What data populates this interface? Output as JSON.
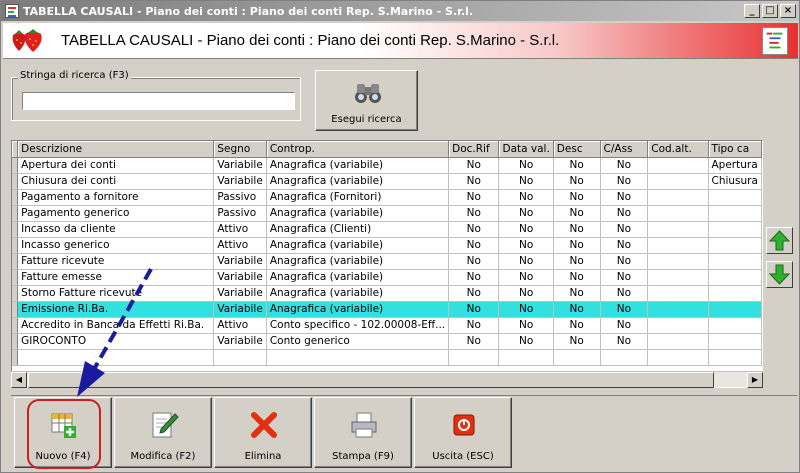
{
  "window": {
    "title": "TABELLA CAUSALI - Piano dei conti : Piano dei conti Rep. S.Marino - S.r.l.",
    "controls": [
      "_",
      "□",
      "×"
    ]
  },
  "banner": {
    "title": "TABELLA CAUSALI - Piano dei conti : Piano dei conti Rep. S.Marino - S.r.l."
  },
  "search": {
    "legend": "Stringa di ricerca (F3)",
    "value": "",
    "button_label": "Esegui ricerca",
    "button_icon": "binoculars-icon"
  },
  "grid": {
    "columns": [
      "Descrizione",
      "Segno",
      "Controp.",
      "Doc.Rif",
      "Data val.",
      "Desc",
      "C/Ass",
      "Cod.alt.",
      "Tipo ca"
    ],
    "rows": [
      [
        "Apertura dei conti",
        "Variabile",
        "Anagrafica (variabile)",
        "No",
        "No",
        "No",
        "No",
        "",
        "Apertura"
      ],
      [
        "Chiusura dei conti",
        "Variabile",
        "Anagrafica (variabile)",
        "No",
        "No",
        "No",
        "No",
        "",
        "Chiusura"
      ],
      [
        "Pagamento a fornitore",
        "Passivo",
        "Anagrafica (Fornitori)",
        "No",
        "No",
        "No",
        "No",
        "",
        ""
      ],
      [
        "Pagamento generico",
        "Passivo",
        "Anagrafica (variabile)",
        "No",
        "No",
        "No",
        "No",
        "",
        ""
      ],
      [
        "Incasso da cliente",
        "Attivo",
        "Anagrafica (Clienti)",
        "No",
        "No",
        "No",
        "No",
        "",
        ""
      ],
      [
        "Incasso generico",
        "Attivo",
        "Anagrafica (variabile)",
        "No",
        "No",
        "No",
        "No",
        "",
        ""
      ],
      [
        "Fatture ricevute",
        "Variabile",
        "Anagrafica (variabile)",
        "No",
        "No",
        "No",
        "No",
        "",
        ""
      ],
      [
        "Fatture emesse",
        "Variabile",
        "Anagrafica (variabile)",
        "No",
        "No",
        "No",
        "No",
        "",
        ""
      ],
      [
        "Storno Fatture ricevute",
        "Variabile",
        "Anagrafica (variabile)",
        "No",
        "No",
        "No",
        "No",
        "",
        ""
      ],
      [
        "Emissione Ri.Ba.",
        "Variabile",
        "Anagrafica (variabile)",
        "No",
        "No",
        "No",
        "No",
        "",
        ""
      ],
      [
        "Accredito in Banca da Effetti Ri.Ba.",
        "Attivo",
        "Conto specifico - 102.00008-Eff...",
        "No",
        "No",
        "No",
        "No",
        "",
        ""
      ],
      [
        "GIROCONTO",
        "Variabile",
        "Conto generico",
        "No",
        "No",
        "No",
        "No",
        "",
        ""
      ]
    ],
    "selected_row": 9
  },
  "side_buttons": [
    {
      "name": "move-up",
      "icon": "up-arrow-icon"
    },
    {
      "name": "move-down",
      "icon": "down-arrow-icon"
    }
  ],
  "toolbar": {
    "buttons": [
      {
        "label": "Nuovo (F4)",
        "icon": "new-record-icon"
      },
      {
        "label": "Modifica (F2)",
        "icon": "edit-icon"
      },
      {
        "label": "Elimina",
        "icon": "delete-icon"
      },
      {
        "label": "Stampa (F9)",
        "icon": "printer-icon"
      },
      {
        "label": "Uscita (ESC)",
        "icon": "exit-icon"
      }
    ]
  },
  "colors": {
    "selected_row": "#33e0e0",
    "annotation_arrow": "#1a1aa0",
    "annotation_circle": "#c82020"
  }
}
